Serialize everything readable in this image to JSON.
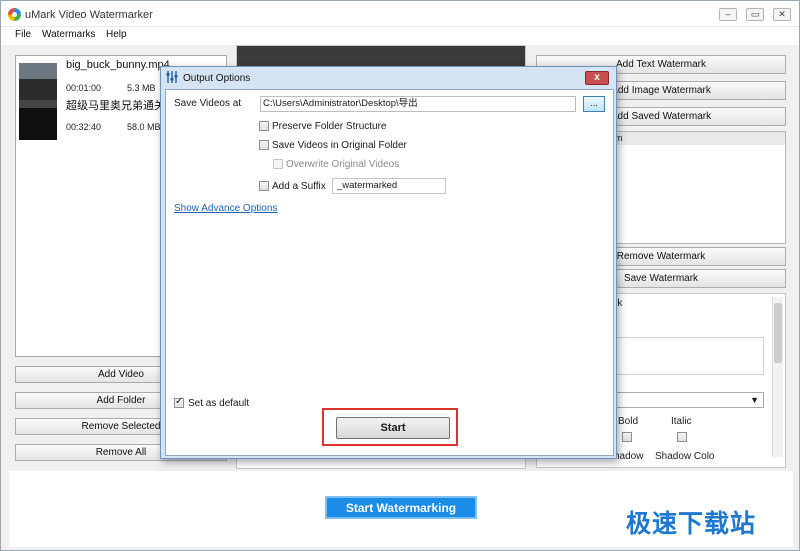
{
  "app": {
    "title": "uMark Video Watermarker",
    "minimize": "–",
    "restore": "▭",
    "close": "✕"
  },
  "menu": [
    "File",
    "Watermarks",
    "Help"
  ],
  "videos": [
    {
      "name": "big_buck_bunny.mp4",
      "duration": "00:01:00",
      "size": "5.3 MB"
    },
    {
      "name": "超级马里奥兄弟通关",
      "duration": "00:32:40",
      "size": "58.0 MB"
    }
  ],
  "left_buttons": {
    "add_video": "Add Video",
    "add_folder": "Add Folder",
    "remove_selected": "Remove Selected",
    "remove_all": "Remove All"
  },
  "right_buttons": {
    "add_text": "Add Text Watermark",
    "add_image": "Add Image Watermark",
    "add_saved": "Add Saved Watermark",
    "remove": "Remove Watermark",
    "save": "Save Watermark"
  },
  "right_list_header": "m",
  "props": {
    "label_mark": "rk",
    "label_bold": "Bold",
    "label_italic": "Italic",
    "label_shadow": "hadow",
    "label_shadow_color": "Shadow Colo"
  },
  "dialog": {
    "title": "Output Options",
    "save_label": "Save Videos at",
    "path": "C:\\Users\\Administrator\\Desktop\\导出",
    "browse": "...",
    "preserve": "Preserve Folder Structure",
    "original": "Save Videos in Original Folder",
    "overwrite": "Overwrite Original Videos",
    "suffix_label": "Add a Suffix",
    "suffix_value": "_watermarked",
    "advance": "Show Advance Options",
    "default": "Set as default",
    "start": "Start",
    "close": "x"
  },
  "start_watermarking": "Start Watermarking",
  "site_watermark": "极速下载站"
}
